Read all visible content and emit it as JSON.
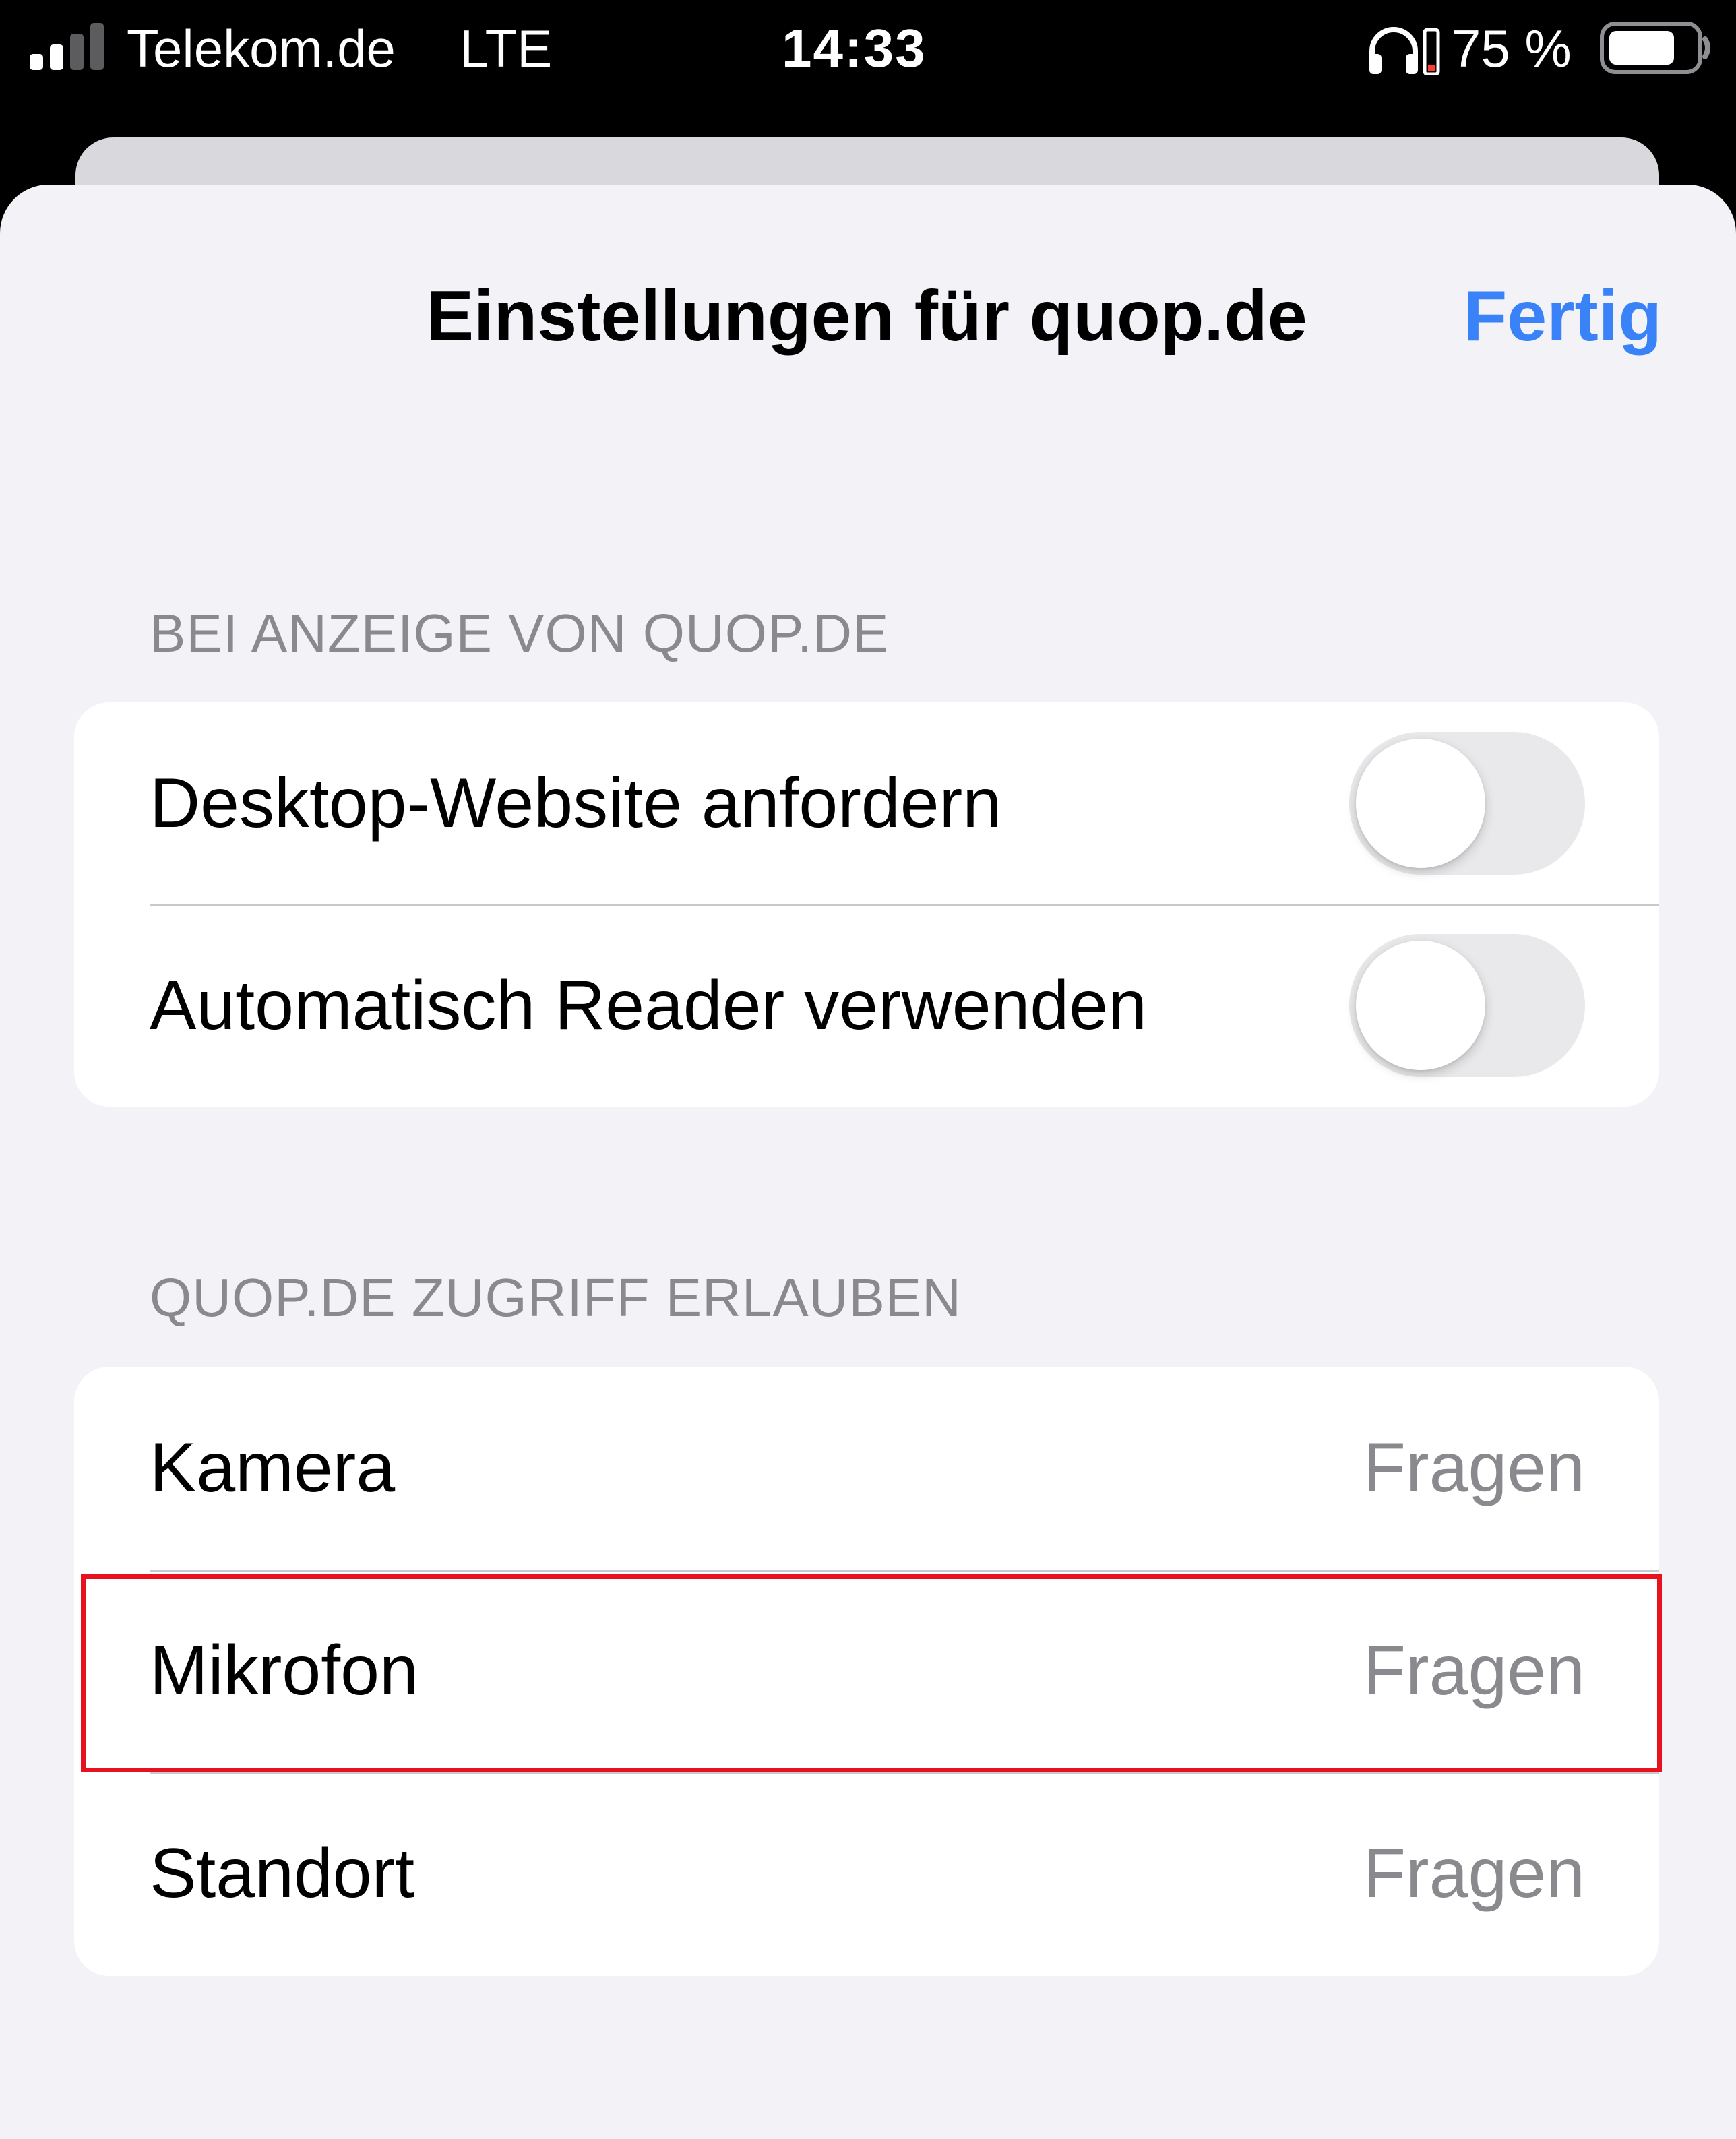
{
  "status_bar": {
    "carrier": "Telekom.de",
    "network": "LTE",
    "time": "14:33",
    "battery_percent": "75 %",
    "icons": [
      "signal-icon",
      "headphones-icon",
      "battery-icon"
    ]
  },
  "sheet": {
    "title": "Einstellungen für quop.de",
    "done_label": "Fertig"
  },
  "sections": [
    {
      "header": "BEI ANZEIGE VON QUOP.DE",
      "rows": [
        {
          "label": "Desktop-Website anfordern",
          "toggle": false
        },
        {
          "label": "Automatisch Reader verwenden",
          "toggle": false
        }
      ]
    },
    {
      "header": "QUOP.DE ZUGRIFF ERLAUBEN",
      "rows": [
        {
          "label": "Kamera",
          "value": "Fragen"
        },
        {
          "label": "Mikrofon",
          "value": "Fragen"
        },
        {
          "label": "Standort",
          "value": "Fragen"
        }
      ]
    }
  ],
  "colors": {
    "accent": "#3a82f7",
    "secondary_text": "#8a8a8e",
    "sheet_background": "#f2f2f7",
    "highlight": "#e8121f"
  }
}
